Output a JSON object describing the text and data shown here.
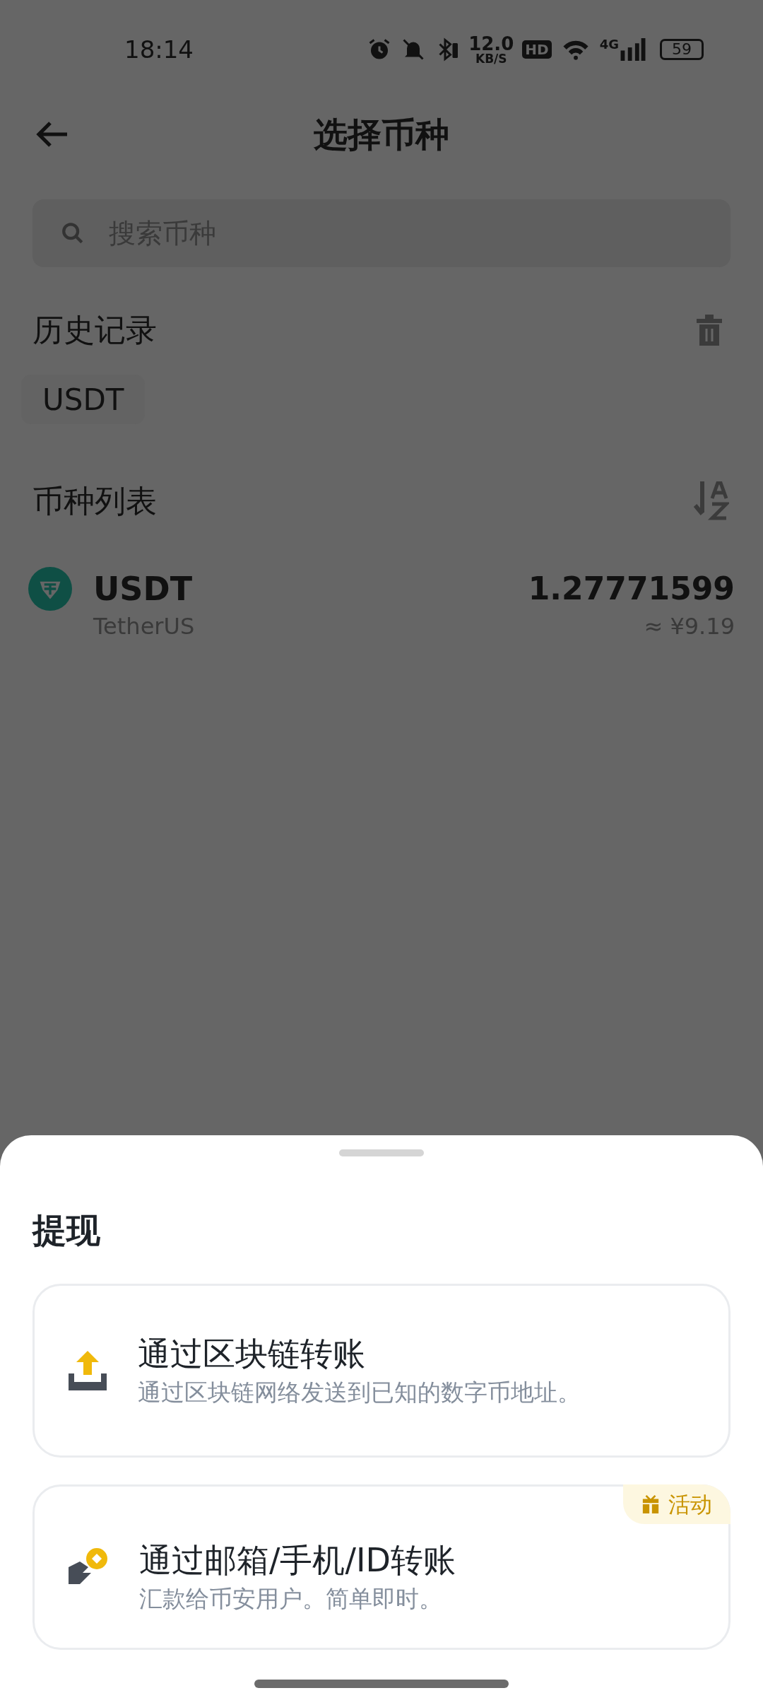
{
  "status_bar": {
    "time": "18:14",
    "speed_value": "12.0",
    "speed_unit": "KB/S",
    "hd": "HD",
    "network": "4G",
    "battery": "59"
  },
  "header": {
    "title": "选择币种"
  },
  "search": {
    "placeholder": "搜索币种"
  },
  "history": {
    "title": "历史记录",
    "chips": [
      "USDT"
    ]
  },
  "coin_list": {
    "title": "币种列表",
    "rows": [
      {
        "symbol": "USDT",
        "name": "TetherUS",
        "amount": "1.27771599",
        "fiat": "≈ ¥9.19"
      }
    ]
  },
  "sheet": {
    "title": "提现",
    "options": [
      {
        "kind": "chain",
        "title": "通过区块链转账",
        "subtitle": "通过区块链网络发送到已知的数字币地址。"
      },
      {
        "kind": "internal",
        "title": "通过邮箱/手机/ID转账",
        "subtitle": "汇款给币安用户。简单即时。",
        "badge": "活动"
      }
    ]
  }
}
